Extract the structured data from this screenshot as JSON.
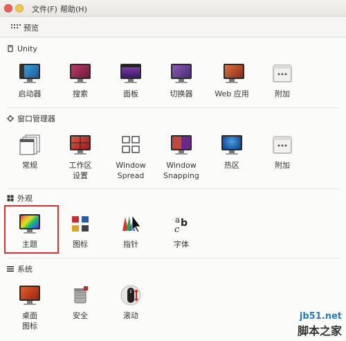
{
  "menubar": {
    "file": "文件(F)",
    "help": "帮助(H)"
  },
  "toolbar": {
    "preview": "预览"
  },
  "sections": {
    "unity": {
      "title": "Unity",
      "items": [
        "启动器",
        "搜索",
        "面板",
        "切换器",
        "Web 应用",
        "附加"
      ]
    },
    "wm": {
      "title": "窗口管理器",
      "items": [
        "常规",
        "工作区\n设置",
        "Window\nSpread",
        "Window\nSnapping",
        "热区",
        "附加"
      ]
    },
    "appearance": {
      "title": "外观",
      "items": [
        "主题",
        "图标",
        "指针",
        "字体"
      ]
    },
    "system": {
      "title": "系统",
      "items": [
        "桌面\n图标",
        "安全",
        "滚动"
      ]
    }
  },
  "watermark": {
    "site": "jb51.net",
    "name": "脚本之家"
  },
  "colors": {
    "selection_border": "#e0302b",
    "ubuntu_purple": "#5e2750"
  }
}
